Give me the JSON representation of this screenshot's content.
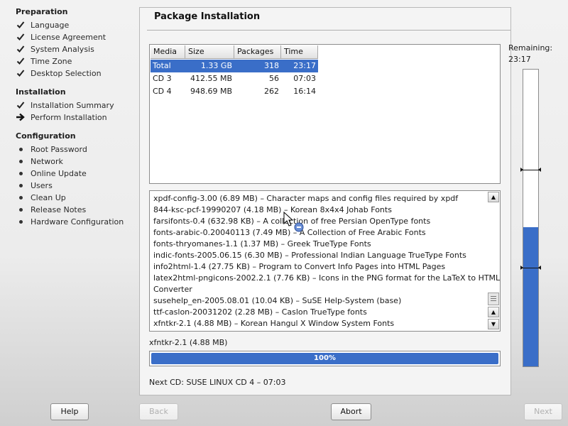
{
  "sidebar": {
    "sections": [
      {
        "title": "Preparation",
        "items": [
          {
            "label": "Language",
            "state": "done"
          },
          {
            "label": "License Agreement",
            "state": "done"
          },
          {
            "label": "System Analysis",
            "state": "done"
          },
          {
            "label": "Time Zone",
            "state": "done"
          },
          {
            "label": "Desktop Selection",
            "state": "done"
          }
        ]
      },
      {
        "title": "Installation",
        "items": [
          {
            "label": "Installation Summary",
            "state": "done"
          },
          {
            "label": "Perform Installation",
            "state": "current"
          }
        ]
      },
      {
        "title": "Configuration",
        "items": [
          {
            "label": "Root Password",
            "state": "pending"
          },
          {
            "label": "Network",
            "state": "pending"
          },
          {
            "label": "Online Update",
            "state": "pending"
          },
          {
            "label": "Users",
            "state": "pending"
          },
          {
            "label": "Clean Up",
            "state": "pending"
          },
          {
            "label": "Release Notes",
            "state": "pending"
          },
          {
            "label": "Hardware Configuration",
            "state": "pending"
          }
        ]
      }
    ]
  },
  "main": {
    "title": "Package Installation",
    "cd_table": {
      "columns": [
        "Media",
        "Size",
        "Packages",
        "Time"
      ],
      "rows": [
        {
          "media": "Total",
          "size": "1.33 GB",
          "packages": "318",
          "time": "23:17",
          "selected": true
        },
        {
          "media": "CD 3",
          "size": "412.55 MB",
          "packages": "56",
          "time": "07:03",
          "selected": false
        },
        {
          "media": "CD 4",
          "size": "948.69 MB",
          "packages": "262",
          "time": "16:14",
          "selected": false
        }
      ]
    },
    "package_log": [
      "xpdf-config-3.00 (6.89 MB) – Character maps and config files required by xpdf",
      "844-ksc-pcf-19990207 (4.18 MB) – Korean 8x4x4 Johab Fonts",
      "farsifonts-0.4 (632.98 KB) – A collection of free Persian OpenType fonts",
      "fonts-arabic-0.20040113 (7.49 MB) – A Collection of Free Arabic Fonts",
      "fonts-thryomanes-1.1 (1.37 MB) – Greek TrueType Fonts",
      "indic-fonts-2005.06.15 (6.30 MB) – Professional Indian Language TrueType Fonts",
      "info2html-1.4 (27.75 KB) – Program to Convert Info Pages into HTML Pages",
      "latex2html-pngicons-2002.2.1 (7.76 KB) – Icons in the PNG format for the LaTeX to HTML",
      "Converter",
      "susehelp_en-2005.08.01 (10.04 KB) – SuSE Help-System (base)",
      "ttf-caslon-20031202 (2.28 MB) – Caslon TrueType fonts",
      "xfntkr-2.1 (4.88 MB) – Korean Hangul X Window System Fonts"
    ],
    "current_package": "xfntkr-2.1 (4.88 MB)",
    "package_progress_percent": 100,
    "package_progress_label": "100%",
    "next_cd": "Next CD: SUSE LINUX CD 4 – 07:03"
  },
  "remaining": {
    "label": "Remaining:",
    "time": "23:17",
    "fill_fraction": 0.47,
    "cd_markers_fraction": [
      0.66,
      0.33
    ]
  },
  "buttons": {
    "help": "Help",
    "back": "Back",
    "abort": "Abort",
    "next": "Next"
  },
  "colors": {
    "accent": "#3a6ec8",
    "selection": "#3a6ec8"
  },
  "icons": {
    "done": "checkmark-icon",
    "current": "arrow-right-icon",
    "pending": "bullet-icon",
    "scroll_up": "triangle-up-icon",
    "scroll_down": "triangle-down-icon"
  }
}
